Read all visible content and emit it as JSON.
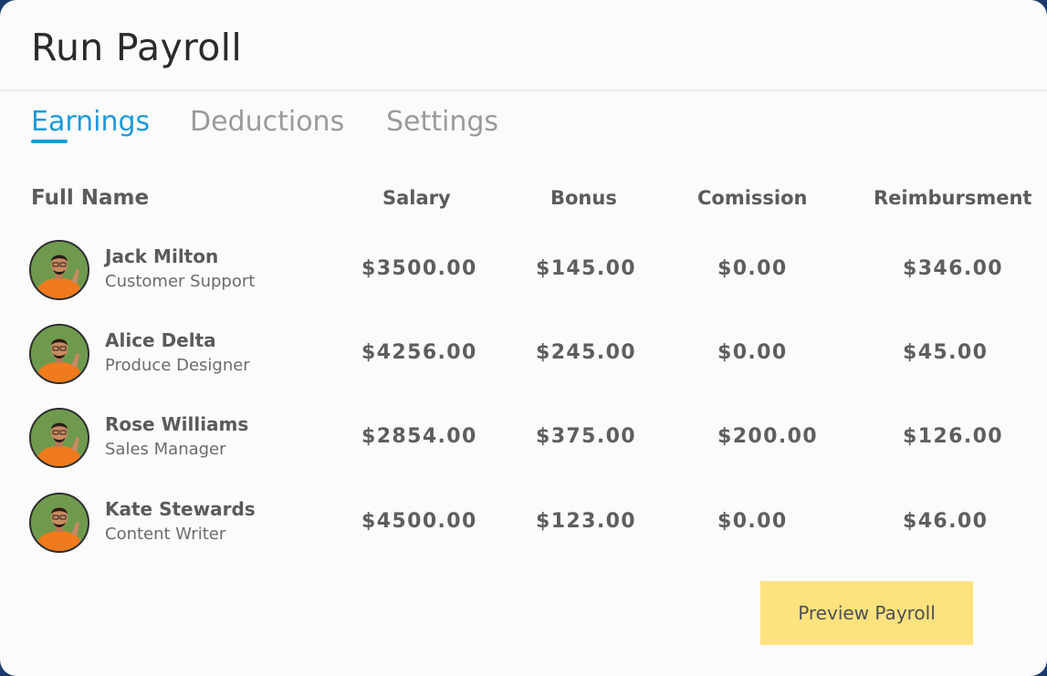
{
  "header": {
    "title": "Run Payroll"
  },
  "tabs": [
    {
      "label": "Earnings",
      "active": true
    },
    {
      "label": "Deductions",
      "active": false
    },
    {
      "label": "Settings",
      "active": false
    }
  ],
  "table": {
    "columns": [
      "Full Name",
      "Salary",
      "Bonus",
      "Comission",
      "Reimbursment"
    ],
    "rows": [
      {
        "name": "Jack Milton",
        "role": "Customer Support",
        "salary": "$3500.00",
        "bonus": "$145.00",
        "commission": "$0.00",
        "reimbursement": "$346.00"
      },
      {
        "name": "Alice Delta",
        "role": "Produce Designer",
        "salary": "$4256.00",
        "bonus": "$245.00",
        "commission": "$0.00",
        "reimbursement": "$45.00"
      },
      {
        "name": "Rose Williams",
        "role": "Sales Manager",
        "salary": "$2854.00",
        "bonus": "$375.00",
        "commission": "$200.00",
        "reimbursement": "$126.00"
      },
      {
        "name": "Kate Stewards",
        "role": "Content Writer",
        "salary": "$4500.00",
        "bonus": "$123.00",
        "commission": "$0.00",
        "reimbursement": "$46.00"
      }
    ]
  },
  "actions": {
    "preview_label": "Preview Payroll"
  },
  "colors": {
    "accent": "#1c9ad9",
    "button": "#fde27e",
    "avatar_bg": "#6f9a4e",
    "shirt": "#f07a1c"
  }
}
